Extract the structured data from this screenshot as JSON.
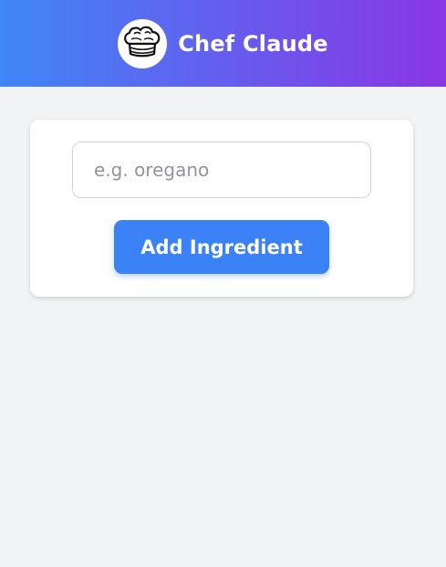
{
  "header": {
    "title": "Chef Claude",
    "logo_icon": "chef-hat-icon",
    "gradient_start": "#3f86f7",
    "gradient_end": "#8a36e4"
  },
  "form": {
    "input_value": "",
    "input_placeholder": "e.g. oregano",
    "add_button_label": "Add Ingredient",
    "button_color": "#3b82f6"
  },
  "page": {
    "background": "#f2f3f5"
  }
}
